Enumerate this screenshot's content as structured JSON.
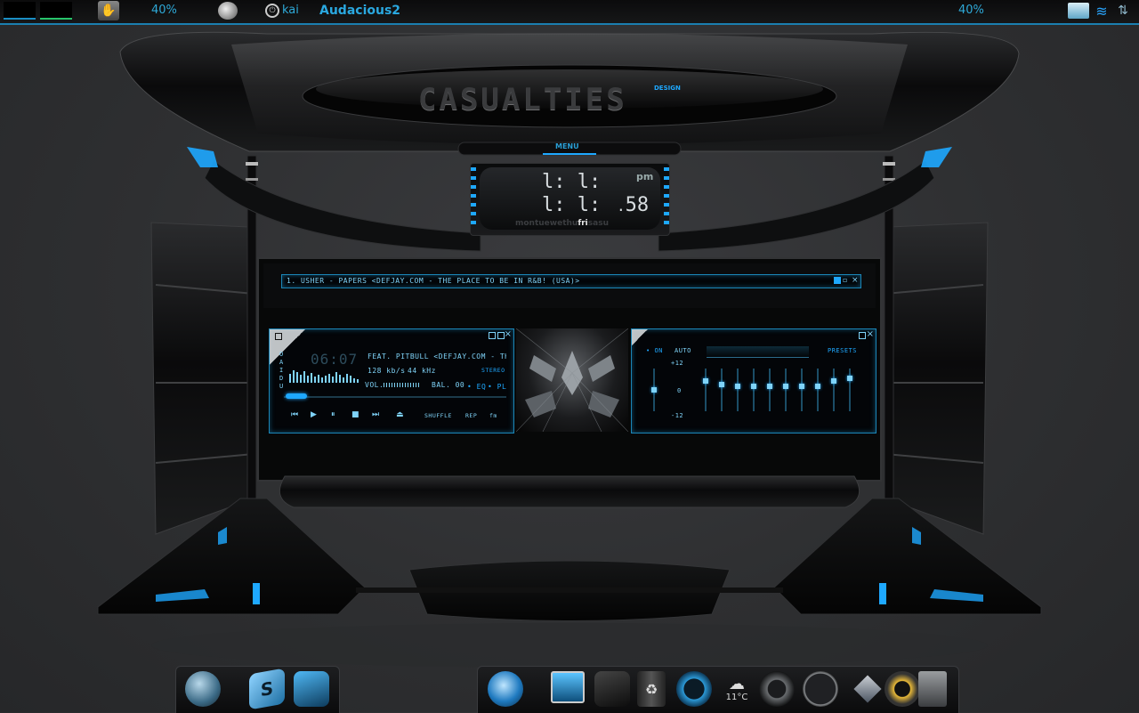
{
  "topbar": {
    "cpu_percent_left": "40%",
    "user": "kai",
    "app_title": "Audacious2",
    "cpu_percent_right": "40%"
  },
  "skin": {
    "brand_text": "CASUALTIES",
    "brand_sub": "DESIGN",
    "menu_label": "MENU",
    "clock": {
      "ampm": "pm",
      "seconds": "58",
      "days": "montuewethu",
      "day_active": "fri",
      "days_tail": "sasu"
    }
  },
  "player": {
    "playlist_entry": "1. USHER - PAPERS <DEFJAY.COM - THE PLACE TO BE IN R&B! (USA)>",
    "mode_letters": "OAIDU",
    "time": "06:07",
    "scroll_title": "FEAT. PITBULL <DEFJAY.COM - THE",
    "bitrate": "128",
    "bitrate_unit": "kb/s",
    "samplerate": "44",
    "samplerate_unit": "kHz",
    "stereo": "STEREO",
    "vol_label": "VOL.",
    "bal_label": "BAL. 00",
    "eq_btn": "EQ",
    "pl_btn": "PL",
    "shuffle": "SHUFFLE",
    "repeat": "REP",
    "fm": "fm"
  },
  "equalizer": {
    "on": "ON",
    "auto": "AUTO",
    "presets": "PRESETS",
    "plus": "+12",
    "zero": "0",
    "minus": "-12",
    "preamp_level": 0.5,
    "band_levels": [
      0.75,
      0.65,
      0.6,
      0.6,
      0.6,
      0.6,
      0.6,
      0.6,
      0.75,
      0.8
    ]
  },
  "dock_left": {
    "icons": [
      "users-icon",
      "photoshop-icon",
      "folder-icon"
    ]
  },
  "dock_right": {
    "icons": [
      "firefox-icon",
      "monitor-icon",
      "folder-dark-icon",
      "trash-icon",
      "quicktime-icon",
      "weather-icon",
      "gauge-icon",
      "clock-icon",
      "diamond-icon",
      "audio-icon",
      "calculator-icon"
    ],
    "weather_temp": "11°C"
  }
}
